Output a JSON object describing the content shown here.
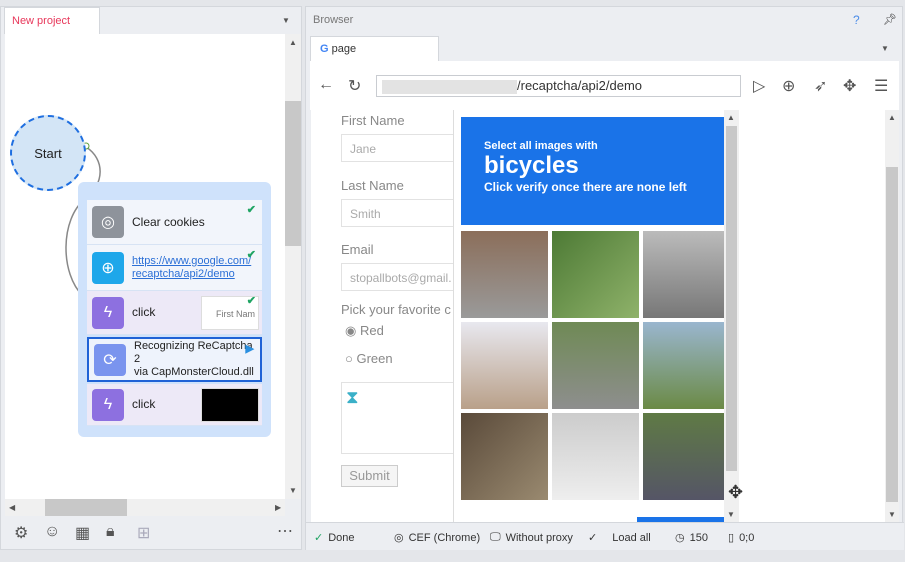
{
  "project": {
    "tab_label": "New project",
    "start_label": "Start",
    "actions": [
      {
        "label": "Clear cookies",
        "icon": "cookie-icon",
        "status": "done"
      },
      {
        "label": "https://www.google.com/recaptcha/api2/demo",
        "line1": "https://www.google.com/",
        "line2": "recaptcha/api2/demo",
        "icon": "globe-icon",
        "status": "done"
      },
      {
        "label": "click",
        "icon": "lightning-icon",
        "status": "done",
        "preview": "First Nam"
      },
      {
        "line1": "Recognizing ReCaptcha 2",
        "line2": "via CapMonsterCloud.dll",
        "icon": "refresh-icon",
        "status": "running"
      },
      {
        "label": "click",
        "icon": "lightning-icon"
      }
    ]
  },
  "browser": {
    "title": "Browser",
    "help": "?",
    "tab_label": "page",
    "url": "/recaptcha/api2/demo"
  },
  "form": {
    "first_name_label": "First Name",
    "first_name_value": "Jane",
    "last_name_label": "Last Name",
    "last_name_value": "Smith",
    "email_label": "Email",
    "email_value": "stopallbots@gmail.",
    "color_label": "Pick your favorite c",
    "options": [
      "Red",
      "Green"
    ],
    "submit": "Submit"
  },
  "captcha": {
    "line1": "Select all images with",
    "keyword": "bicycles",
    "line3": "Click verify once there are none left"
  },
  "status": {
    "state": "Done",
    "engine": "CEF (Chrome)",
    "proxy": "Without proxy",
    "load": "Load all",
    "timeout": "150",
    "coords": "0;0"
  },
  "colors": {
    "accent": "#1a73e8",
    "tab_red": "#e8375a",
    "check": "#1fa463"
  }
}
